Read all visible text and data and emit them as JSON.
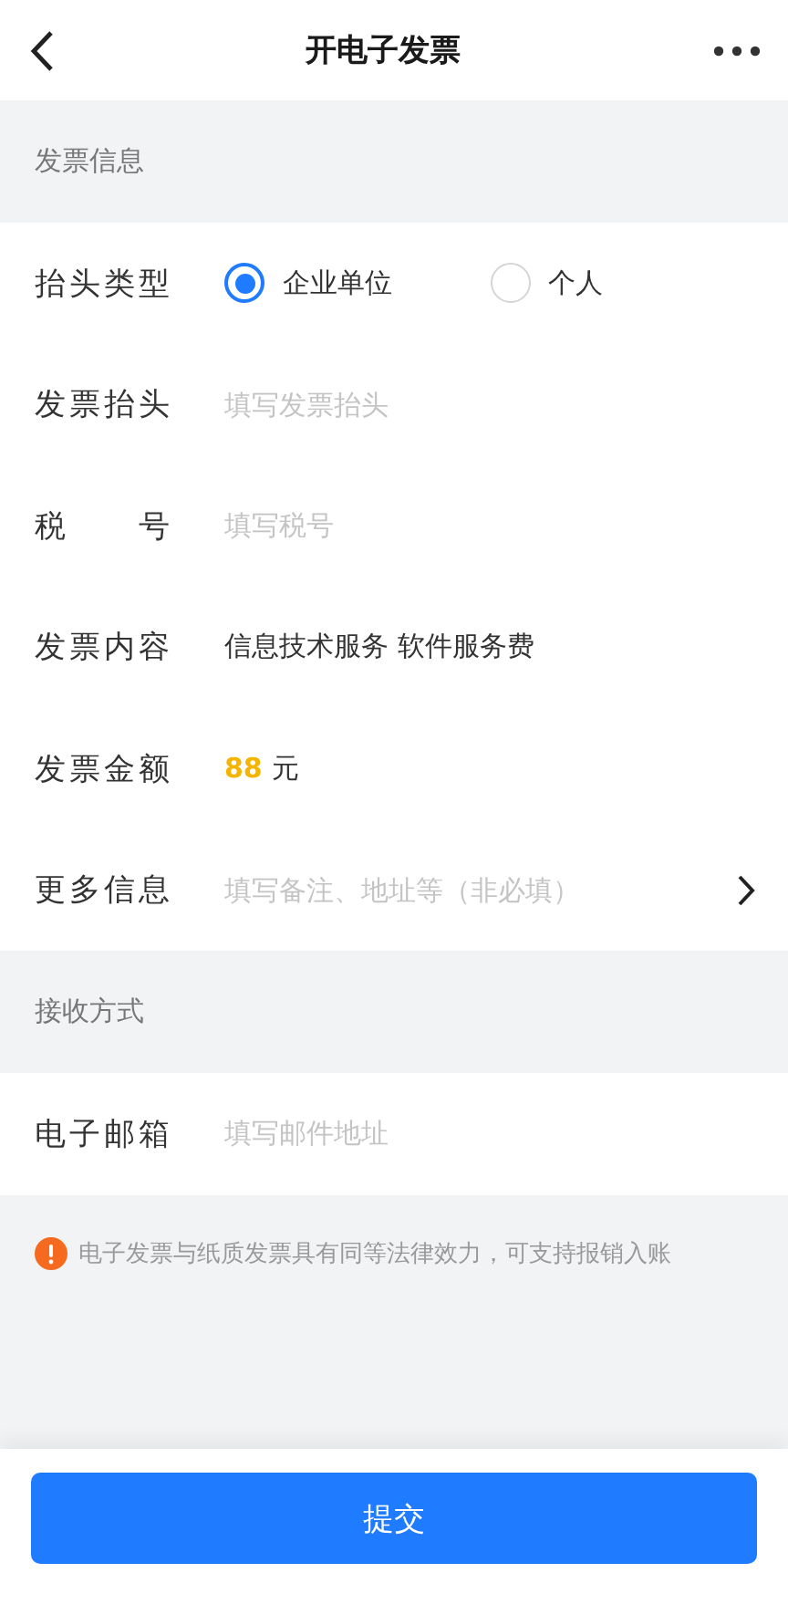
{
  "nav": {
    "title": "开电子发票"
  },
  "sections": [
    {
      "title": "发票信息",
      "rows": [
        {
          "kind": "radio",
          "label": "抬头类型",
          "options": [
            {
              "label": "企业单位",
              "selected": true
            },
            {
              "label": "个人",
              "selected": false
            }
          ]
        },
        {
          "kind": "input",
          "label": "发票抬头",
          "placeholder": "填写发票抬头"
        },
        {
          "kind": "input",
          "label": "税号",
          "placeholder": "填写税号"
        },
        {
          "kind": "text",
          "label": "发票内容",
          "value": "信息技术服务 软件服务费"
        },
        {
          "kind": "amount",
          "label": "发票金额",
          "amount": "88",
          "unit": "元"
        },
        {
          "kind": "link",
          "label": "更多信息",
          "placeholder": "填写备注、地址等（非必填）"
        }
      ]
    },
    {
      "title": "接收方式",
      "rows": [
        {
          "kind": "input",
          "label": "电子邮箱",
          "placeholder": "填写邮件地址"
        }
      ]
    }
  ],
  "notice": "电子发票与纸质发票具有同等法律效力，可支持报销入账",
  "submit": "提交"
}
